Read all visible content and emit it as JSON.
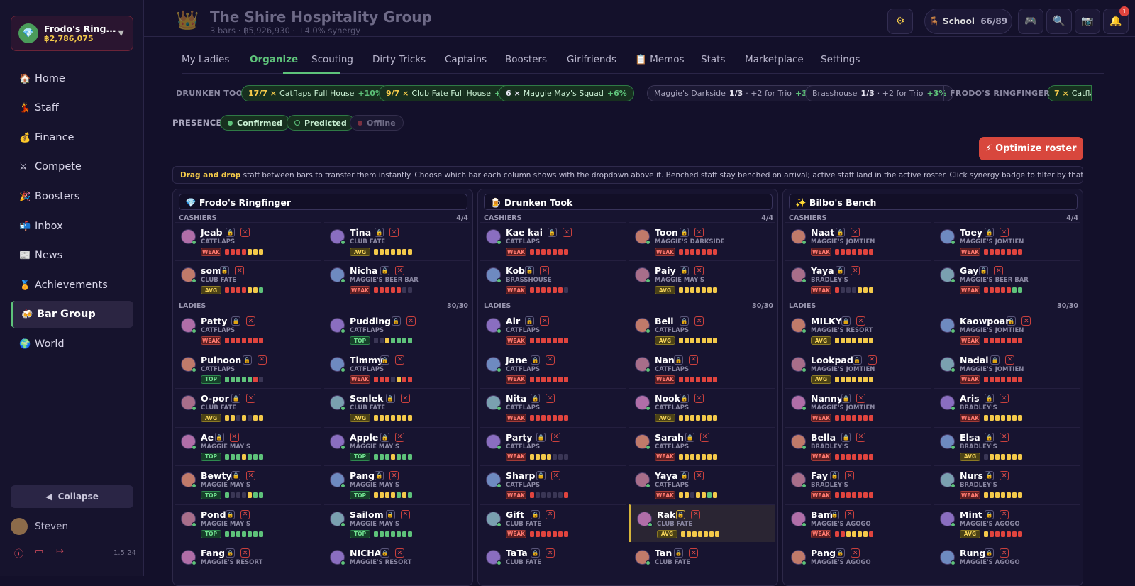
{
  "sidebar": {
    "account_name": "Frodo's Ring...",
    "balance": "฿2,786,075",
    "nav": [
      {
        "label": "Home",
        "icon": "🏠"
      },
      {
        "label": "Staff",
        "icon": "💃"
      },
      {
        "label": "Finance",
        "icon": "💰"
      },
      {
        "label": "Compete",
        "icon": "⚔"
      },
      {
        "label": "Boosters",
        "icon": "🎉"
      },
      {
        "label": "Inbox",
        "icon": "📬"
      },
      {
        "label": "News",
        "icon": "📰"
      },
      {
        "label": "Achievements",
        "icon": "🏅"
      },
      {
        "label": "Bar Group",
        "icon": "🍻"
      },
      {
        "label": "World",
        "icon": "🌍"
      }
    ],
    "active": "Bar Group",
    "collapse": "Collapse",
    "user": "Steven",
    "version": "1.5.24"
  },
  "header": {
    "title": "The Shire Hospitality Group",
    "subtitle": "3 bars · ฿5,926,930 · +4.0% synergy",
    "school_label": "School",
    "school_value": "66/89",
    "notif_count": "1"
  },
  "tabs": [
    "My Ladies",
    "Organize",
    "Scouting",
    "Dirty Tricks",
    "Captains",
    "Boosters",
    "Girlfriends",
    "📋 Memos",
    "Stats",
    "Marketplace",
    "Settings"
  ],
  "synergy": {
    "label": "DRUNKEN TOOK",
    "label2": "FRODO'S RINGFINGER",
    "pills": [
      {
        "count": "17/7 ×",
        "name": "Catflaps Full House",
        "pct": "+10%"
      },
      {
        "count": "9/7 ×",
        "name": "Club Fate Full House",
        "pct": "+10%"
      },
      {
        "count": "6 ×",
        "name": "Maggie May's Squad",
        "pct": "+6%"
      },
      {
        "name": "Maggie's Darkside",
        "count": "1/3",
        "extra": "· +2 for Trio",
        "pct": "+3%"
      },
      {
        "name": "Brasshouse",
        "count": "1/3",
        "extra": "· +2 for Trio",
        "pct": "+3%"
      },
      {
        "count": "7 ×",
        "name": "Catflaps"
      }
    ]
  },
  "presence": {
    "label": "PRESENCE:",
    "confirmed": "Confirmed",
    "predicted": "Predicted",
    "offline": "Offline"
  },
  "optimize": "⚡ Optimize roster",
  "info": {
    "bold": "Drag and drop",
    "text": " staff between bars to transfer them instantly. Choose which bar each column shows with the dropdown above it. Benched staff stay benched on arrival; active staff land in the active roster. Click synergy badge to filter by that bar."
  },
  "colors": {
    "weak": "#e0443e",
    "avg": "#f3c94a",
    "top": "#5ec27a",
    "empty": "#3a3655"
  },
  "panels": [
    {
      "title": "💎 Frodo's Ringfinger",
      "cashiers_label": "CASHIERS",
      "cashiers_count": "4/4",
      "ladies_label": "LADIES",
      "ladies_count": "30/30",
      "cashiers": [
        {
          "name": "Jeab",
          "bar": "CATFLAPS",
          "grade": "WEAK",
          "bars": "rrrryyy"
        },
        {
          "name": "Tina",
          "bar": "CLUB FATE",
          "grade": "AVG",
          "bars": "yyyyyyy"
        },
        {
          "name": "som",
          "bar": "CLUB FATE",
          "grade": "AVG",
          "bars": "rrrryyg"
        },
        {
          "name": "Nicha",
          "bar": "MAGGIE'S BEER BAR",
          "grade": "WEAK",
          "bars": "rrrrree"
        }
      ],
      "ladies": [
        {
          "name": "Patty",
          "bar": "CATFLAPS",
          "grade": "WEAK",
          "bars": "rrrrrrr"
        },
        {
          "name": "Pudding",
          "bar": "CATFLAPS",
          "grade": "TOP",
          "bars": "eeygggg"
        },
        {
          "name": "Puinoon",
          "bar": "CATFLAPS",
          "grade": "TOP",
          "bars": "gggggre"
        },
        {
          "name": "Timmy",
          "bar": "CATFLAPS",
          "grade": "WEAK",
          "bars": "rrreyrr"
        },
        {
          "name": "O-por",
          "bar": "CLUB FATE",
          "grade": "AVG",
          "bars": "yyeyeyy"
        },
        {
          "name": "Senlek",
          "bar": "CLUB FATE",
          "grade": "AVG",
          "bars": "yyyyyyy"
        },
        {
          "name": "Ae",
          "bar": "MAGGIE MAY'S",
          "grade": "TOP",
          "bars": "gggyggg"
        },
        {
          "name": "Apple",
          "bar": "MAGGIE MAY'S",
          "grade": "TOP",
          "bars": "gggyggg"
        },
        {
          "name": "Bewty",
          "bar": "MAGGIE MAY'S",
          "grade": "TOP",
          "bars": "geeeygg"
        },
        {
          "name": "Pang",
          "bar": "MAGGIE MAY'S",
          "grade": "TOP",
          "bars": "yyyygyg"
        },
        {
          "name": "Pond",
          "bar": "MAGGIE MAY'S",
          "grade": "TOP",
          "bars": "ggggggg"
        },
        {
          "name": "Sailom",
          "bar": "MAGGIE MAY'S",
          "grade": "TOP",
          "bars": "ggggggg"
        },
        {
          "name": "Fang",
          "bar": "MAGGIE'S RESORT",
          "grade": "",
          "bars": ""
        },
        {
          "name": "NICHA",
          "bar": "MAGGIE'S RESORT",
          "grade": "",
          "bars": ""
        }
      ]
    },
    {
      "title": "🍺 Drunken Took",
      "cashiers_label": "CASHIERS",
      "cashiers_count": "4/4",
      "ladies_label": "LADIES",
      "ladies_count": "30/30",
      "cashiers": [
        {
          "name": "Kae kai",
          "bar": "CATFLAPS",
          "grade": "WEAK",
          "bars": "rrrrrrr"
        },
        {
          "name": "Toon",
          "bar": "MAGGIE'S DARKSIDE",
          "grade": "WEAK",
          "bars": "rrrrrrr"
        },
        {
          "name": "Kob",
          "bar": "BRASSHOUSE",
          "grade": "WEAK",
          "bars": "rrrrrre"
        },
        {
          "name": "Paiy",
          "bar": "MAGGIE MAY'S",
          "grade": "AVG",
          "bars": "yyyyyyy"
        }
      ],
      "ladies": [
        {
          "name": "Air",
          "bar": "CATFLAPS",
          "grade": "WEAK",
          "bars": "rrrrrrr"
        },
        {
          "name": "Bell",
          "bar": "CATFLAPS",
          "grade": "AVG",
          "bars": "yyyyyyy"
        },
        {
          "name": "Jane",
          "bar": "CATFLAPS",
          "grade": "WEAK",
          "bars": "rrrrrrr"
        },
        {
          "name": "Nan",
          "bar": "CATFLAPS",
          "grade": "WEAK",
          "bars": "rrrrrrr"
        },
        {
          "name": "Nita",
          "bar": "CATFLAPS",
          "grade": "WEAK",
          "bars": "rrrrrrr"
        },
        {
          "name": "Nook",
          "bar": "CATFLAPS",
          "grade": "AVG",
          "bars": "yyyyyyy"
        },
        {
          "name": "Party",
          "bar": "CATFLAPS",
          "grade": "WEAK",
          "bars": "yyyyeee"
        },
        {
          "name": "Sarah",
          "bar": "CATFLAPS",
          "grade": "WEAK",
          "bars": "yyyyyyy"
        },
        {
          "name": "Sharp",
          "bar": "CATFLAPS",
          "grade": "WEAK",
          "bars": "reeeeer"
        },
        {
          "name": "Yaya",
          "bar": "CATFLAPS",
          "grade": "WEAK",
          "bars": "yyeyygy"
        },
        {
          "name": "Gift",
          "bar": "CLUB FATE",
          "grade": "WEAK",
          "bars": "rrrrrrr"
        },
        {
          "name": "Rak",
          "bar": "CLUB FATE",
          "grade": "AVG",
          "bars": "yyyyyyy",
          "selected": true
        },
        {
          "name": "TaTa",
          "bar": "CLUB FATE",
          "grade": "",
          "bars": ""
        },
        {
          "name": "Tan",
          "bar": "CLUB FATE",
          "grade": "",
          "bars": ""
        }
      ]
    },
    {
      "title": "✨ Bilbo's Bench",
      "cashiers_label": "CASHIERS",
      "cashiers_count": "4/4",
      "ladies_label": "LADIES",
      "ladies_count": "30/30",
      "cashiers": [
        {
          "name": "Naat",
          "bar": "MAGGIE'S JOMTIEN",
          "grade": "WEAK",
          "bars": "rrrrrrr"
        },
        {
          "name": "Toey",
          "bar": "MAGGIE'S JOMTIEN",
          "grade": "WEAK",
          "bars": "rrrrrrr"
        },
        {
          "name": "Yaya",
          "bar": "BRADLEY'S",
          "grade": "WEAK",
          "bars": "reeeyyy"
        },
        {
          "name": "Gay",
          "bar": "MAGGIE'S BEER BAR",
          "grade": "WEAK",
          "bars": "rrrrrgg"
        }
      ],
      "ladies": [
        {
          "name": "MILKY",
          "bar": "MAGGIE'S RESORT",
          "grade": "AVG",
          "bars": "yyyyyyy"
        },
        {
          "name": "Kaowpoan",
          "bar": "MAGGIE'S JOMTIEN",
          "grade": "WEAK",
          "bars": "rrrrrrr"
        },
        {
          "name": "Lookpad",
          "bar": "MAGGIE'S JOMTIEN",
          "grade": "AVG",
          "bars": "yyyyyyy"
        },
        {
          "name": "Nadai",
          "bar": "MAGGIE'S JOMTIEN",
          "grade": "WEAK",
          "bars": "rrrrrrr"
        },
        {
          "name": "Nanny",
          "bar": "MAGGIE'S JOMTIEN",
          "grade": "WEAK",
          "bars": "rrrrrrr"
        },
        {
          "name": "Aris",
          "bar": "BRADLEY'S",
          "grade": "WEAK",
          "bars": "yyyyyyy"
        },
        {
          "name": "Bella",
          "bar": "BRADLEY'S",
          "grade": "WEAK",
          "bars": "rrrrrrr"
        },
        {
          "name": "Elsa",
          "bar": "BRADLEY'S",
          "grade": "AVG",
          "bars": "eyyyyyy"
        },
        {
          "name": "Fay",
          "bar": "BRADLEY'S",
          "grade": "WEAK",
          "bars": "rrrrrrr"
        },
        {
          "name": "Nurs",
          "bar": "BRADLEY'S",
          "grade": "WEAK",
          "bars": "yyyyyyy"
        },
        {
          "name": "Bam",
          "bar": "MAGGIE'S AGOGO",
          "grade": "WEAK",
          "bars": "rryyyyr"
        },
        {
          "name": "Mint",
          "bar": "MAGGIE'S AGOGO",
          "grade": "AVG",
          "bars": "yrrrrrr"
        },
        {
          "name": "Pang",
          "bar": "MAGGIE'S AGOGO",
          "grade": "",
          "bars": ""
        },
        {
          "name": "Rung",
          "bar": "MAGGIE'S AGOGO",
          "grade": "",
          "bars": ""
        }
      ]
    }
  ]
}
